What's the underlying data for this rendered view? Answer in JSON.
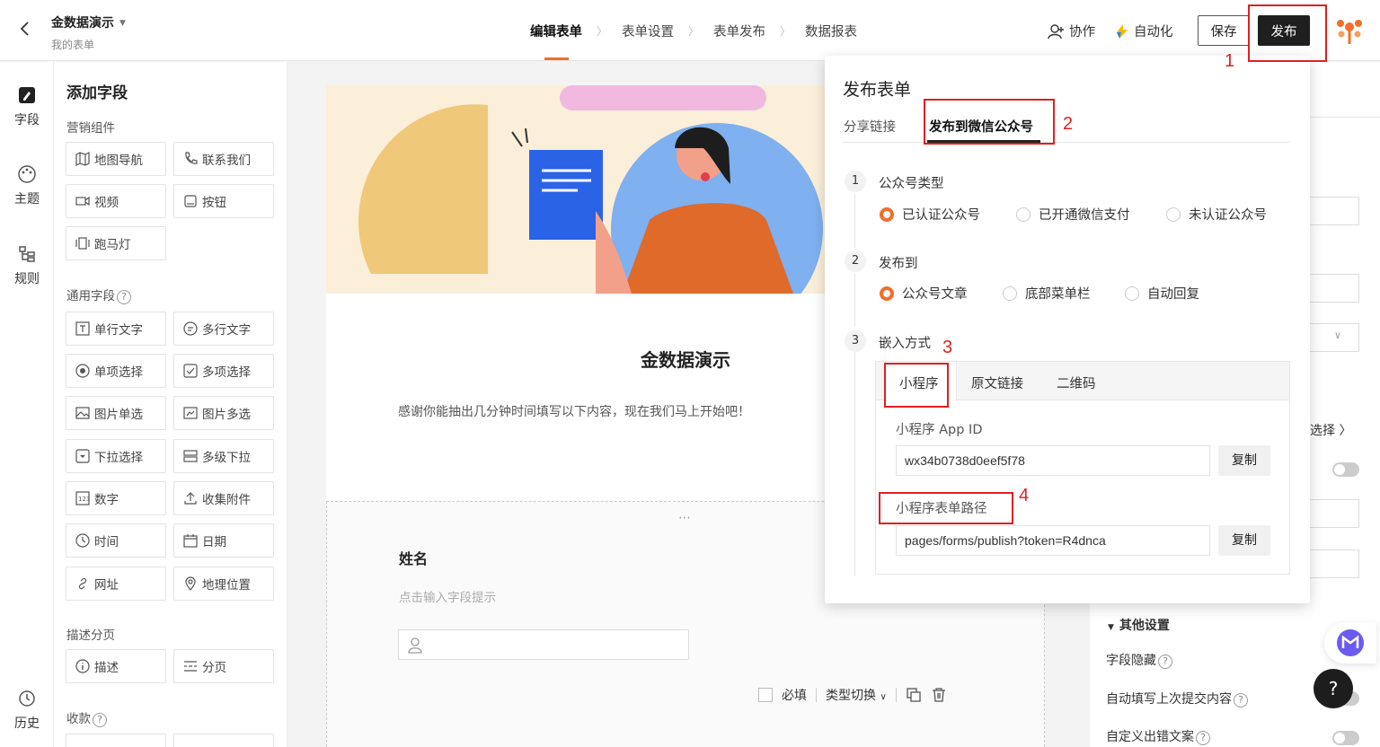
{
  "header": {
    "form_title": "金数据演示",
    "form_subtitle": "我的表单",
    "steps": [
      "编辑表单",
      "表单设置",
      "表单发布",
      "数据报表"
    ],
    "collab": "协作",
    "automation": "自动化",
    "save": "保存",
    "publish": "发布"
  },
  "annotations": [
    "1",
    "2",
    "3",
    "4"
  ],
  "leftnav": {
    "items": [
      "字段",
      "主题",
      "规则"
    ],
    "history": "历史"
  },
  "field_panel": {
    "title": "添加字段",
    "sections": {
      "marketing": "营销组件",
      "common": "通用字段",
      "desc": "描述分页",
      "payment": "收款"
    },
    "marketing_items": [
      {
        "label": "地图导航",
        "icon": "map-icon"
      },
      {
        "label": "联系我们",
        "icon": "phone-icon"
      },
      {
        "label": "视频",
        "icon": "video-icon"
      },
      {
        "label": "按钮",
        "icon": "button-icon"
      },
      {
        "label": "跑马灯",
        "icon": "marquee-icon"
      }
    ],
    "common_items": [
      {
        "label": "单行文字",
        "icon": "text-icon"
      },
      {
        "label": "多行文字",
        "icon": "textarea-icon"
      },
      {
        "label": "单项选择",
        "icon": "radio-icon"
      },
      {
        "label": "多项选择",
        "icon": "checkbox-icon"
      },
      {
        "label": "图片单选",
        "icon": "image-icon"
      },
      {
        "label": "图片多选",
        "icon": "images-icon"
      },
      {
        "label": "下拉选择",
        "icon": "dropdown-icon"
      },
      {
        "label": "多级下拉",
        "icon": "cascade-icon"
      },
      {
        "label": "数字",
        "icon": "number-icon"
      },
      {
        "label": "收集附件",
        "icon": "upload-icon"
      },
      {
        "label": "时间",
        "icon": "clock-icon"
      },
      {
        "label": "日期",
        "icon": "calendar-icon"
      },
      {
        "label": "网址",
        "icon": "link-icon"
      },
      {
        "label": "地理位置",
        "icon": "location-icon"
      }
    ],
    "desc_items": [
      {
        "label": "描述",
        "icon": "info-icon"
      },
      {
        "label": "分页",
        "icon": "pagebreak-icon"
      }
    ]
  },
  "canvas": {
    "heading": "金数据演示",
    "description": "感谢你能抽出几分钟时间填写以下内容，现在我们马上开始吧！",
    "field_label": "姓名",
    "field_hint": "点击输入字段提示",
    "required": "必填",
    "type_switch": "类型切换"
  },
  "right_panel": {
    "select_link": "选择",
    "other_settings": "其他设置",
    "hide_field": "字段隐藏",
    "autofill": "自动填写上次提交内容",
    "custom_error": "自定义出错文案"
  },
  "popup": {
    "title": "发布表单",
    "tab_share": "分享链接",
    "tab_wechat": "发布到微信公众号",
    "step1": {
      "num": "1",
      "label": "公众号类型",
      "options": [
        "已认证公众号",
        "已开通微信支付",
        "未认证公众号"
      ],
      "selected": 0
    },
    "step2": {
      "num": "2",
      "label": "发布到",
      "options": [
        "公众号文章",
        "底部菜单栏",
        "自动回复"
      ],
      "selected": 0
    },
    "step3": {
      "num": "3",
      "label": "嵌入方式"
    },
    "embed_tabs": [
      "小程序",
      "原文链接",
      "二维码"
    ],
    "appid_label": "小程序 App ID",
    "appid_value": "wx34b0738d0eef5f78",
    "path_label": "小程序表单路径",
    "path_value": "pages/forms/publish?token=R4dnca",
    "copy": "复制"
  },
  "float": {
    "help": "?"
  },
  "colors": {
    "accent": "#f26e2a",
    "annotation": "#e02020",
    "dark": "#1f1f1f"
  }
}
